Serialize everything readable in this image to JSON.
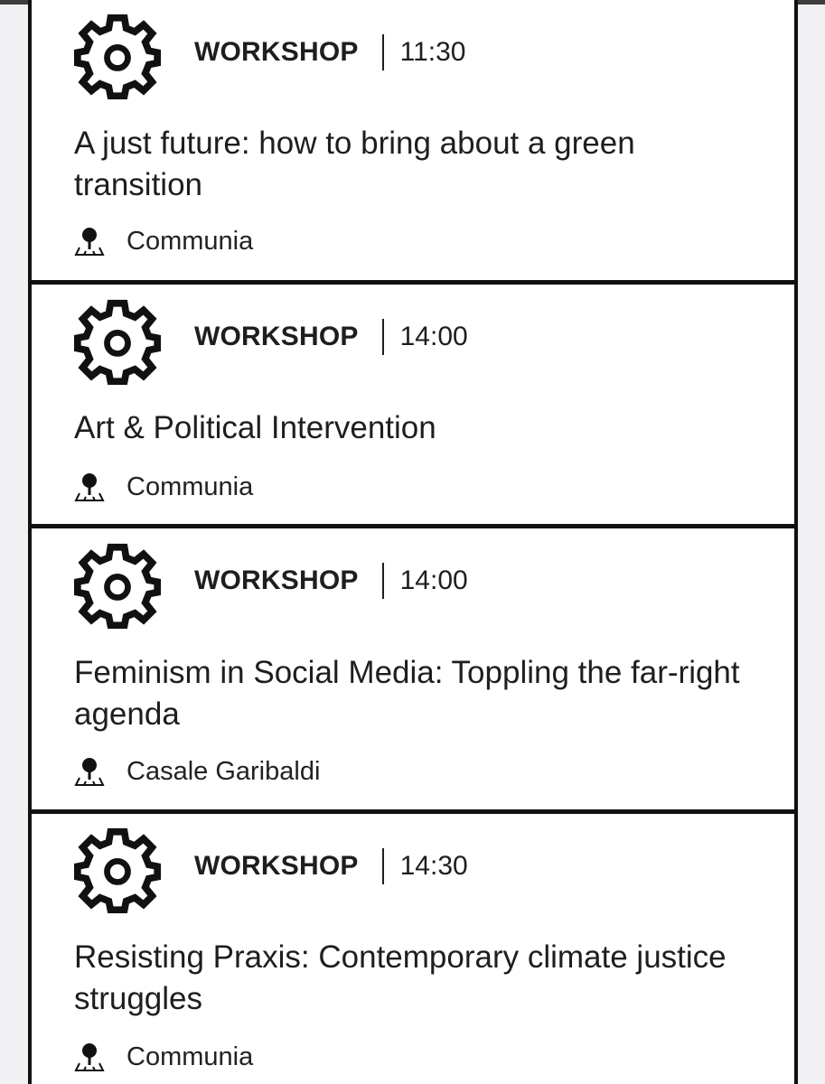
{
  "events": [
    {
      "type": "WORKSHOP",
      "time": "11:30",
      "title": "A just future: how to bring about a green transition",
      "location": "Communia",
      "icon": "gear-icon"
    },
    {
      "type": "WORKSHOP",
      "time": "14:00",
      "title": "Art & Political Intervention",
      "location": "Communia",
      "icon": "gear-icon"
    },
    {
      "type": "WORKSHOP",
      "time": "14:00",
      "title": "Feminism in Social Media: Toppling the far-right agenda",
      "location": "Casale Garibaldi",
      "icon": "gear-icon"
    },
    {
      "type": "WORKSHOP",
      "time": "14:30",
      "title": "Resisting Praxis: Contemporary climate justice struggles",
      "location": "Communia",
      "icon": "gear-icon"
    }
  ],
  "location_icon": "map-pin-icon",
  "colors": {
    "text": "#1e1e1e",
    "border": "#111111",
    "background": "#f1f1f3",
    "card": "#ffffff"
  }
}
